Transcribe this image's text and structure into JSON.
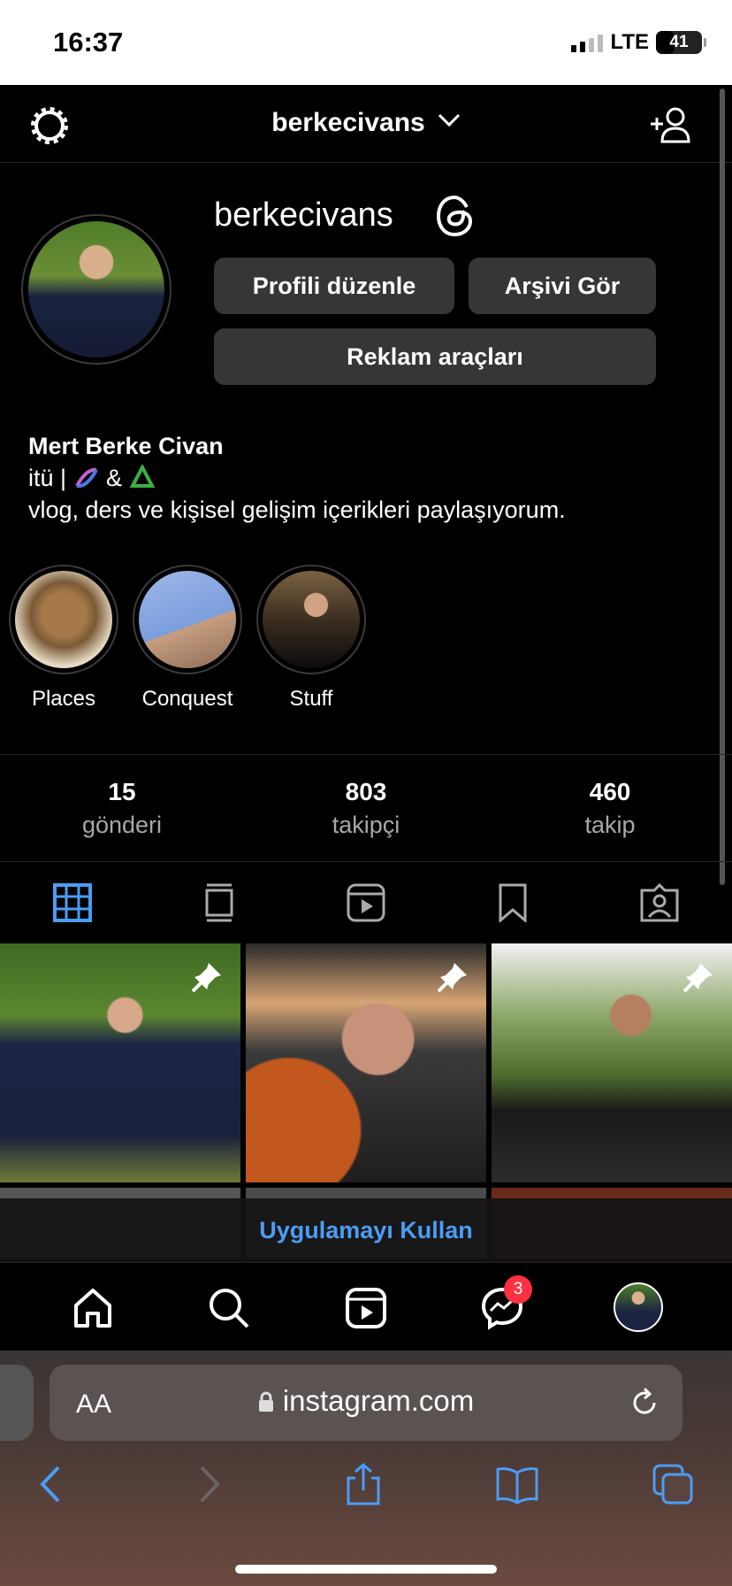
{
  "status_bar": {
    "time": "16:37",
    "network": "LTE",
    "battery": "41"
  },
  "header": {
    "username": "berkecivans"
  },
  "profile": {
    "username": "berkecivans",
    "edit_label": "Profili düzenle",
    "archive_label": "Arşivi Gör",
    "ads_label": "Reklam araçları",
    "full_name": "Mert Berke Civan",
    "bio_line1_prefix": "itü | ",
    "bio_line1_mid": " & ",
    "bio_line2": "vlog, ders ve kişisel gelişim içerikleri paylaşıyorum."
  },
  "highlights": [
    {
      "label": "Places"
    },
    {
      "label": "Conquest"
    },
    {
      "label": "Stuff"
    }
  ],
  "stats": {
    "posts": {
      "value": "15",
      "label": "gönderi"
    },
    "followers": {
      "value": "803",
      "label": "takipçi"
    },
    "following": {
      "value": "460",
      "label": "takip"
    }
  },
  "use_app_label": "Uygulamayı Kullan",
  "bottom_nav": {
    "messages_badge": "3"
  },
  "safari": {
    "aa_label": "AA",
    "host": "instagram.com"
  },
  "colors": {
    "accent": "#4a9df5",
    "badge": "#ff3040",
    "button_bg": "#363636"
  }
}
